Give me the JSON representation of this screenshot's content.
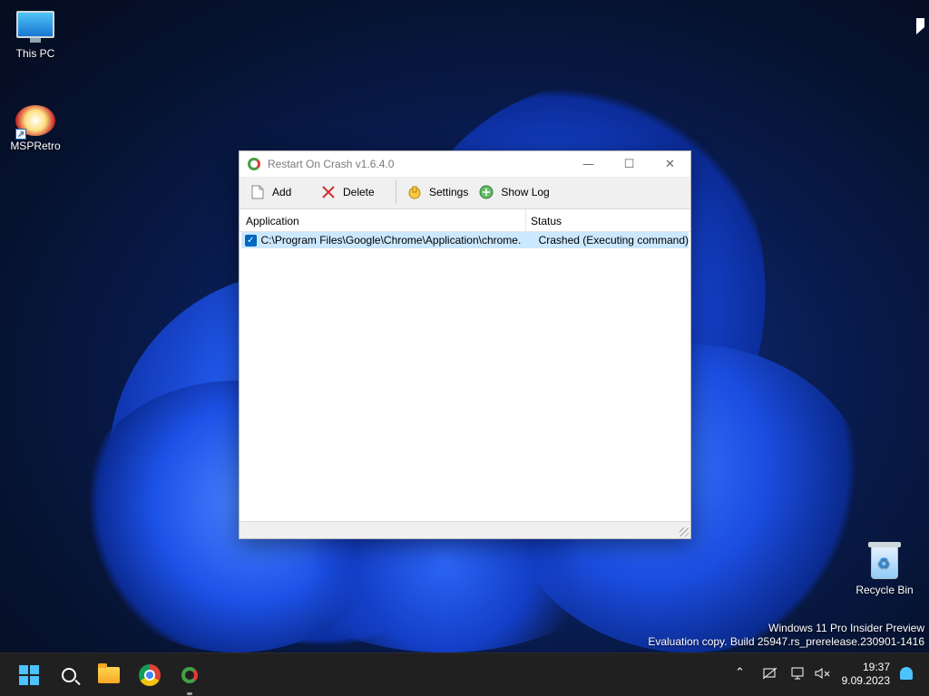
{
  "desktop": {
    "icons": [
      {
        "label": "This PC"
      },
      {
        "label": "MSPRetro"
      },
      {
        "label": "Recycle Bin"
      }
    ],
    "watermark": {
      "line1": "Windows 11 Pro Insider Preview",
      "line2": "Evaluation copy. Build 25947.rs_prerelease.230901-1416"
    }
  },
  "window": {
    "title": "Restart On Crash v1.6.4.0",
    "controls": {
      "minimize": "—",
      "maximize": "☐",
      "close": "✕"
    },
    "toolbar": {
      "add": "Add",
      "delete": "Delete",
      "settings": "Settings",
      "show_log": "Show Log"
    },
    "columns": {
      "application": "Application",
      "status": "Status"
    },
    "rows": [
      {
        "checked": true,
        "application": "C:\\Program Files\\Google\\Chrome\\Application\\chrome.exe",
        "status": "Crashed (Executing command)"
      }
    ]
  },
  "taskbar": {
    "items": [
      "start-button",
      "search-button",
      "file-explorer",
      "chrome",
      "restart-on-crash"
    ],
    "clock": {
      "time": "19:37",
      "date": "9.09.2023"
    }
  },
  "colors": {
    "accent": "#0067c0",
    "selection": "#cce8ff",
    "taskbar": "#202020"
  }
}
